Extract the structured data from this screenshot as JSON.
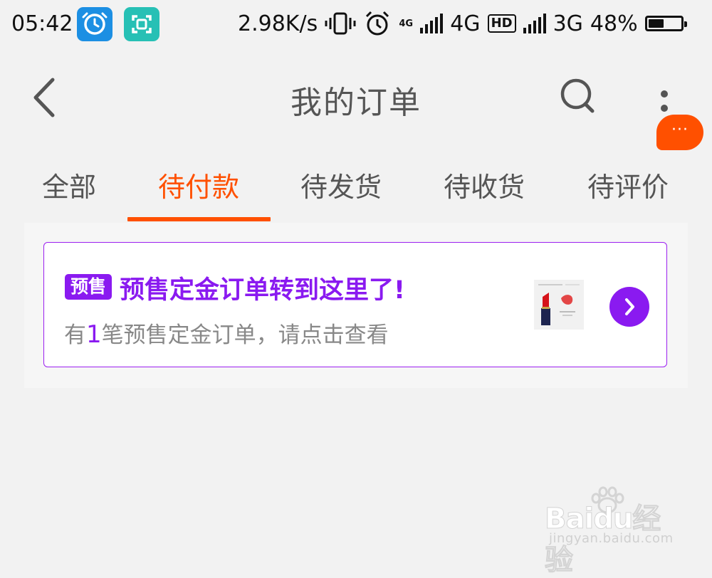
{
  "status_bar": {
    "time": "05:42",
    "speed": "2.98K/s",
    "net_small": "4G",
    "net1": "4G",
    "hd": "HD",
    "net2": "3G",
    "battery": "48%",
    "battery_level": 0.48,
    "icons": [
      "clock-app-icon",
      "scan-app-icon",
      "vibrate-icon",
      "alarm-icon",
      "signal-icon",
      "battery-icon"
    ]
  },
  "header": {
    "title": "我的订单",
    "icons": [
      "back-arrow-icon",
      "search-icon",
      "more-vertical-icon"
    ],
    "chat_bubble": "···"
  },
  "tabs": [
    {
      "label": "全部",
      "active": false
    },
    {
      "label": "待付款",
      "active": true
    },
    {
      "label": "待发货",
      "active": false
    },
    {
      "label": "待收货",
      "active": false
    },
    {
      "label": "待评价",
      "active": false
    }
  ],
  "presale": {
    "badge": "预售",
    "title": "预售定金订单转到这里了!",
    "desc_prefix": "有",
    "count": "1",
    "desc_suffix": "笔预售定金订单，请点击查看",
    "icons": [
      "lipstick-thumbnail",
      "chevron-right-icon"
    ]
  },
  "watermark": {
    "brand": "Baidu经验",
    "sub": "jingyan.baidu.com"
  },
  "colors": {
    "accent": "#ff5000",
    "presale_purple": "#8a1af0"
  }
}
